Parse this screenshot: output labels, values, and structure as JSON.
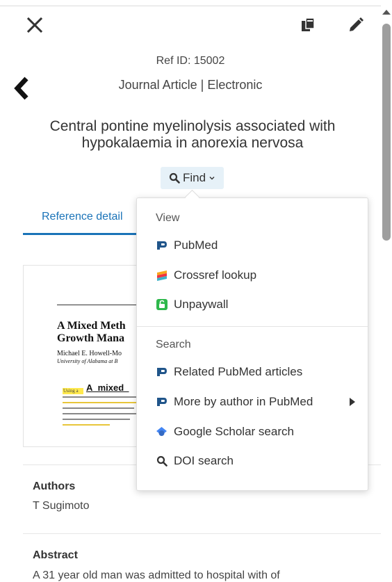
{
  "header": {
    "close_icon": "close-icon",
    "copy_icon": "copy-icon",
    "edit_icon": "pencil-icon"
  },
  "reference": {
    "ref_id": "Ref ID: 15002",
    "type": "Journal Article | Electronic",
    "title": "Central pontine myelinolysis associated with hypokalaemia in anorexia nervosa"
  },
  "find_button": {
    "label": "Find",
    "icon": "search-icon"
  },
  "tabs": [
    {
      "label": "Reference detail",
      "active": true
    }
  ],
  "preview": {
    "heading_line1": "A Mixed Meth",
    "heading_line2": "Growth Mana",
    "author": "Michael E. Howell-Mo",
    "affiliation": "University of Alabama at B",
    "highlight_word": "Using a",
    "overlay_text": "A_mixed_"
  },
  "sections": {
    "authors_label": "Authors",
    "authors_value": "T Sugimoto",
    "abstract_label": "Abstract",
    "abstract_value": "A 31 year old man was admitted to hospital with of"
  },
  "menu": {
    "view_label": "View",
    "search_label": "Search",
    "view_items": [
      {
        "label": "PubMed",
        "icon": "pubmed-icon"
      },
      {
        "label": "Crossref lookup",
        "icon": "crossref-icon"
      },
      {
        "label": "Unpaywall",
        "icon": "unpaywall-icon"
      }
    ],
    "search_items": [
      {
        "label": "Related PubMed articles",
        "icon": "pubmed-icon"
      },
      {
        "label": "More by author in PubMed",
        "icon": "pubmed-icon",
        "has_submenu": true
      },
      {
        "label": "Google Scholar search",
        "icon": "google-scholar-icon"
      },
      {
        "label": "DOI search",
        "icon": "search-icon"
      }
    ]
  },
  "colors": {
    "accent": "#1a73b8",
    "find_bg": "#e6f1f8",
    "unpaywall": "#2eb84b",
    "scholar": "#4285f4",
    "highlight": "#ffe94d"
  }
}
